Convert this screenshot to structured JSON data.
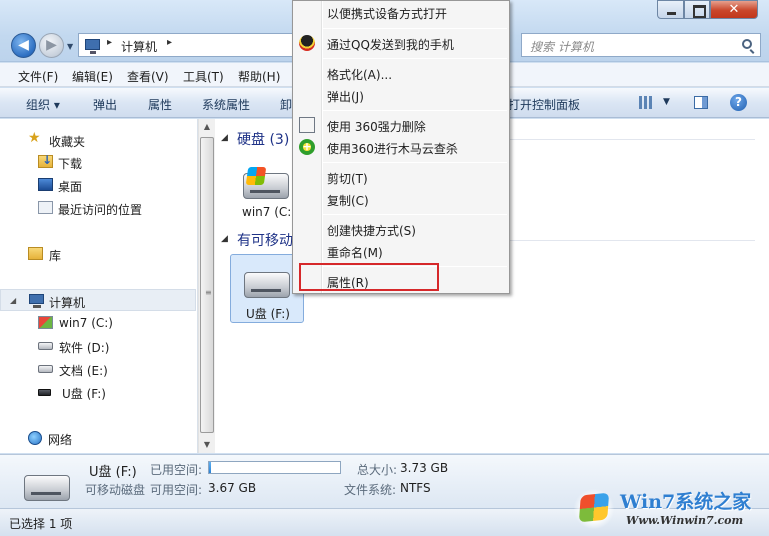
{
  "address": {
    "path": "计算机",
    "search_placeholder": "搜索 计算机"
  },
  "window_controls": {
    "close_label": "✕"
  },
  "menubar": [
    "文件(F)",
    "编辑(E)",
    "查看(V)",
    "工具(T)",
    "帮助(H)"
  ],
  "toolbar": {
    "items": [
      "组织 ▾",
      "弹出",
      "属性",
      "系统属性",
      "卸",
      "打开控制面板"
    ],
    "help": "?"
  },
  "nav": {
    "favorites": "收藏夹",
    "downloads": "下载",
    "desktop": "桌面",
    "recent": "最近访问的位置",
    "libraries": "库",
    "computer": "计算机",
    "drive_c": "win7 (C:)",
    "drive_d": "软件 (D:)",
    "drive_e": "文档 (E:)",
    "drive_f": "U盘 (F:)",
    "network": "网络"
  },
  "content": {
    "group_hdd": "硬盘 (3)",
    "tile_c": "win7 (C:)",
    "group_removable": "有可移动",
    "tile_f": "U盘 (F:)"
  },
  "context_menu": {
    "items": [
      "以便携式设备方式打开",
      "通过QQ发送到我的手机",
      "格式化(A)...",
      "弹出(J)",
      "使用 360强力删除",
      "使用360进行木马云查杀",
      "剪切(T)",
      "复制(C)",
      "创建快捷方式(S)",
      "重命名(M)",
      "属性(R)"
    ],
    "highlighted": "属性(R)"
  },
  "details": {
    "name": "U盘 (F:)",
    "type": "可移动磁盘",
    "used_label": "已用空间:",
    "free_label": "可用空间:",
    "free_value": "3.67 GB",
    "total_label": "总大小:",
    "total_value": "3.73 GB",
    "fs_label": "文件系统:",
    "fs_value": "NTFS",
    "used_fraction": 0.016
  },
  "status": {
    "selected": "已选择 1 项"
  },
  "watermark": {
    "brand": "Win7系统之家",
    "url": "Www.Winwin7.com"
  }
}
